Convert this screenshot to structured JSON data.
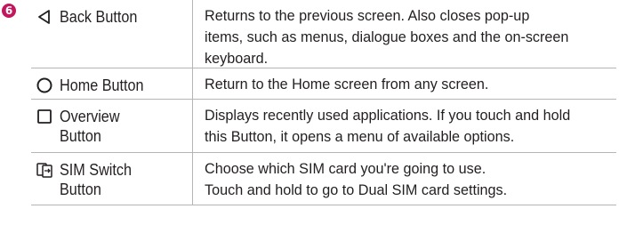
{
  "step": {
    "number": "6",
    "color": "#c2185b"
  },
  "rows": [
    {
      "icon": "back-triangle-icon",
      "key_label": "Back Button",
      "description_lines": [
        "Returns to the previous screen. Also closes pop-up",
        "items, such as menus, dialogue boxes and the on-screen",
        "keyboard."
      ]
    },
    {
      "icon": "home-circle-icon",
      "key_label": "Home Button",
      "description_lines": [
        "Return to the Home screen from any screen."
      ]
    },
    {
      "icon": "overview-square-icon",
      "key_label": "Overview\nButton",
      "description_lines": [
        "Displays recently used applications. If you touch and hold",
        "this Button, it opens a menu of available options."
      ]
    },
    {
      "icon": "sim-switch-icon",
      "key_label": "SIM Switch\nButton",
      "description_lines": [
        "Choose which SIM card you're going to use.",
        "Touch and hold to go to Dual SIM card settings."
      ]
    }
  ]
}
